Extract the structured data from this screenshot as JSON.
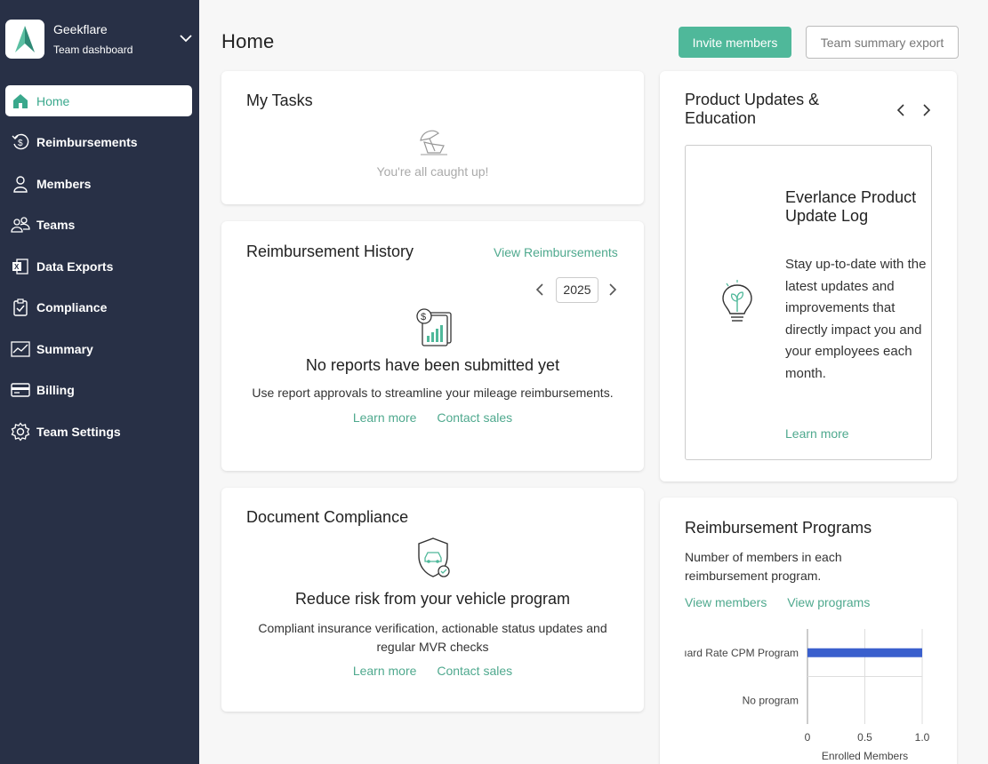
{
  "brand": {
    "name": "Geekflare",
    "subtitle": "Team dashboard"
  },
  "nav": [
    {
      "label": "Home",
      "icon": "home-icon",
      "active": true
    },
    {
      "label": "Reimbursements",
      "icon": "reimbursement-icon",
      "active": false
    },
    {
      "label": "Members",
      "icon": "member-icon",
      "active": false
    },
    {
      "label": "Teams",
      "icon": "teams-icon",
      "active": false
    },
    {
      "label": "Data Exports",
      "icon": "excel-icon",
      "active": false
    },
    {
      "label": "Compliance",
      "icon": "clipboard-check-icon",
      "active": false
    },
    {
      "label": "Summary",
      "icon": "chart-line-icon",
      "active": false
    },
    {
      "label": "Billing",
      "icon": "credit-card-icon",
      "active": false
    },
    {
      "label": "Team Settings",
      "icon": "gear-icon",
      "active": false
    }
  ],
  "header": {
    "title": "Home",
    "invite_label": "Invite members",
    "export_label": "Team summary export"
  },
  "tasks": {
    "title": "My Tasks",
    "empty_text": "You're all caught up!"
  },
  "history": {
    "title": "Reimbursement History",
    "view_link": "View Reimbursements",
    "year": "2025",
    "empty_title": "No reports have been submitted yet",
    "empty_body": "Use report approvals to streamline your mileage reimbursements.",
    "learn_more": "Learn more",
    "contact_sales": "Contact sales"
  },
  "compliance": {
    "title": "Document Compliance",
    "headline": "Reduce risk from your vehicle program",
    "body_line1": "Compliant insurance verification, actionable status updates and",
    "body_line2": "regular MVR checks",
    "learn_more": "Learn more",
    "contact_sales": "Contact sales"
  },
  "updates": {
    "title_line1": "Product Updates &",
    "title_line2": "Education",
    "card_title": "Everlance Product Update Log",
    "card_body": "Stay up-to-date with the latest updates and improvements that directly impact you and your employees each month.",
    "learn_more": "Learn more"
  },
  "programs": {
    "title": "Reimbursement Programs",
    "desc_line1": "Number of members in each",
    "desc_line2": "reimbursement program.",
    "view_members": "View members",
    "view_programs": "View programs"
  },
  "colors": {
    "accent": "#4fb89a",
    "sidebar": "#283046",
    "bar": "#3a5fcd"
  },
  "chart_data": {
    "type": "bar",
    "orientation": "horizontal",
    "categories": [
      "Standard Rate CPM Program",
      "No program"
    ],
    "category_labels_visible": [
      "ıard Rate CPM Program",
      "No program"
    ],
    "values": [
      1,
      0
    ],
    "xlabel": "Enrolled Members",
    "xticks": [
      "0",
      "0.5",
      "1.0"
    ],
    "xlim": [
      0,
      1
    ],
    "grid": true
  }
}
